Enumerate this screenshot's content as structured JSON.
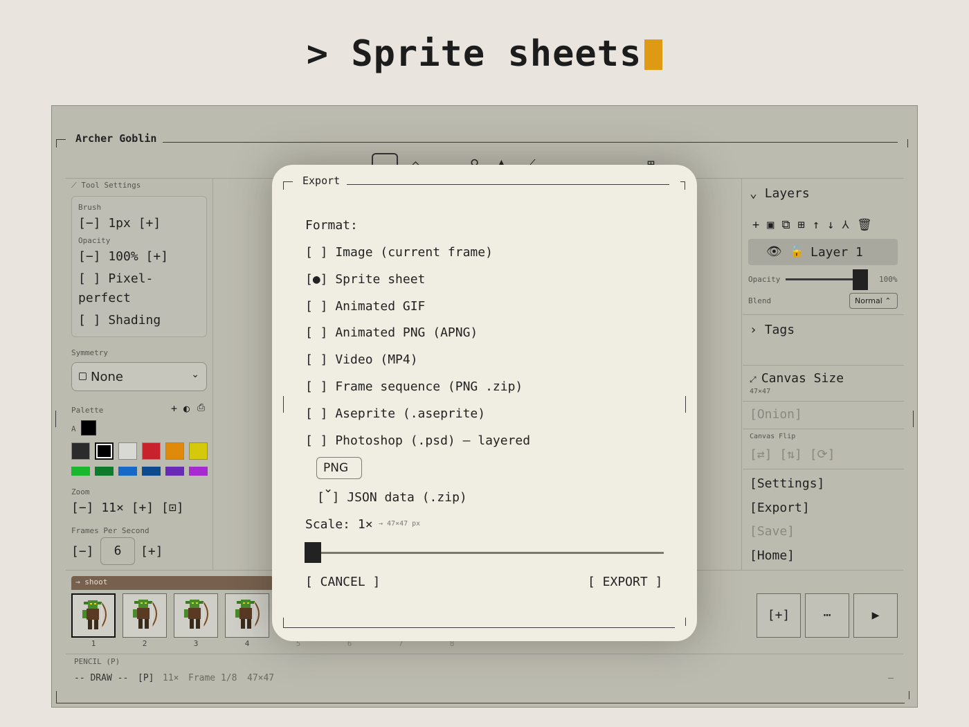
{
  "headline": {
    "prompt": ">",
    "title": "Sprite sheets"
  },
  "app": {
    "title": "Archer Goblin",
    "tool_settings": {
      "header": "Tool Settings",
      "brush_label": "Brush",
      "brush_value": "[−] 1px [+]",
      "opacity_label": "Opacity",
      "opacity_value": "[−] 100% [+]",
      "pixel_perfect": "[ ] Pixel-",
      "pixel_perfect_cont": "perfect",
      "shading": "[ ] Shading"
    },
    "symmetry": {
      "label": "Symmetry",
      "value": "None"
    },
    "palette": {
      "label": "Palette",
      "current_color": "#000000",
      "colors_row1": [
        "#2b2b2b",
        "#000000",
        "#d8d8d4",
        "#c8232c",
        "#e08a0b",
        "#d4c90b"
      ],
      "colors_row2": [
        "#19b82f",
        "#0e7a2b",
        "#1769c8",
        "#0d4a8e",
        "#6a2ab8",
        "#a72ad0"
      ]
    },
    "zoom": {
      "label": "Zoom",
      "value": "[−] 11× [+] [⊡]"
    },
    "fps": {
      "label": "Frames Per Second",
      "minus": "[−]",
      "value": "6",
      "plus": "[+]"
    },
    "layers": {
      "header": "Layers",
      "layer_name": "Layer 1",
      "opacity_label": "Opacity",
      "opacity_value": "100%",
      "opacity_fraction": 1.0,
      "blend_label": "Blend",
      "blend_value": "Normal ⌃"
    },
    "tags_header": "Tags",
    "canvas_size": {
      "header": "Canvas Size",
      "value": "47×47"
    },
    "onion": "[Onion]",
    "canvas_flip": {
      "label": "Canvas Flip",
      "buttons": "[⇄] [⇅] [⟳]"
    },
    "menu": {
      "settings": "[Settings]",
      "export": "[Export]",
      "save": "[Save]",
      "home": "[Home]"
    },
    "timeline": {
      "tag": "→ shoot",
      "frame_numbers": [
        "1",
        "2",
        "3",
        "4",
        "5",
        "6",
        "7",
        "8"
      ],
      "add_frame": "[+]",
      "more": "⋯",
      "play": "▶"
    },
    "status": {
      "tool": "PENCIL (P)",
      "mode": "-- DRAW --",
      "key": "[P]",
      "zoom": "11×",
      "frame": "Frame 1/8",
      "size": "47×47",
      "right": "—"
    }
  },
  "dialog": {
    "title": "Export",
    "format_label": "Format:",
    "options": [
      "[ ] Image (current frame)",
      "[●] Sprite sheet",
      "[ ] Animated GIF",
      "[ ] Animated PNG (APNG)",
      "[ ] Video (MP4)",
      "[ ] Frame sequence (PNG .zip)",
      "[ ] Aseprite (.aseprite)",
      "[ ] Photoshop (.psd) — layered"
    ],
    "image_format": "PNG ⌄",
    "json_option": "[ ] JSON data (.zip)",
    "scale_label": "Scale: 1×",
    "scale_hint": "→ 47×47 px",
    "scale_fraction": 0.0,
    "cancel": "[ CANCEL ]",
    "export": "[ EXPORT ]"
  }
}
